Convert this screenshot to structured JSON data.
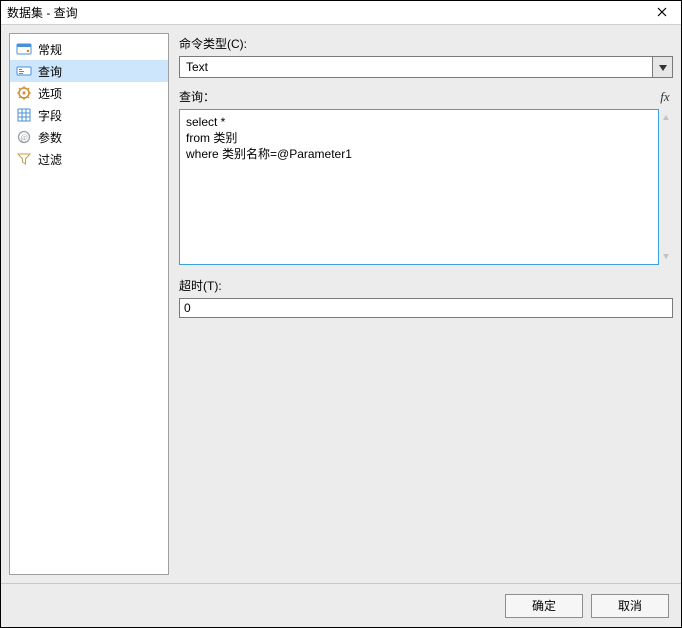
{
  "window": {
    "title": "数据集 - 查询"
  },
  "sidebar": {
    "items": [
      {
        "label": "常规",
        "icon": "general-icon"
      },
      {
        "label": "查询",
        "icon": "query-icon",
        "selected": true
      },
      {
        "label": "选项",
        "icon": "options-icon"
      },
      {
        "label": "字段",
        "icon": "fields-icon"
      },
      {
        "label": "参数",
        "icon": "parameters-icon"
      },
      {
        "label": "过滤",
        "icon": "filter-icon"
      }
    ]
  },
  "main": {
    "command_type_label": "命令类型(C):",
    "command_type_value": "Text",
    "query_label": "查询：",
    "query_text": "select *\nfrom 类别\nwhere 类别名称=@Parameter1",
    "timeout_label": "超时(T):",
    "timeout_value": "0",
    "fx_label": "fx"
  },
  "footer": {
    "ok": "确定",
    "cancel": "取消"
  }
}
